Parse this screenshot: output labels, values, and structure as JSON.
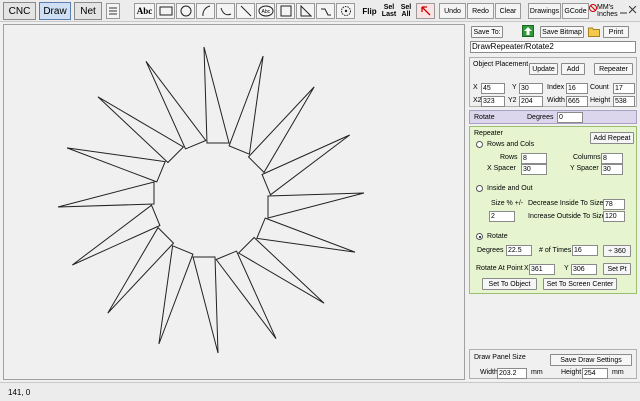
{
  "toolbar": {
    "tabs": [
      "CNC",
      "Draw",
      "Net"
    ],
    "active_tab": "Draw",
    "text_tool": "Abc",
    "flip_label": "Flip",
    "sel_last_label": [
      "Sel",
      "Last"
    ],
    "sel_all_label": [
      "Sel",
      "All"
    ],
    "undo_label": "Undo",
    "redo_label": "Redo",
    "clear_label": "Clear",
    "drawings_label": "Drawings",
    "gcode_label": "GCode",
    "units_label": [
      "MM's",
      "Inches"
    ]
  },
  "panel": {
    "save_to_label": "Save To:",
    "save_bitmap_label": "Save Bitmap",
    "print_label": "Print",
    "filename": "DrawRepeater/Rotate2",
    "placement": {
      "title": "Object Placement",
      "update_label": "Update",
      "add_label": "Add",
      "repeater_label": "Repeater",
      "x_label": "X",
      "x_value": "45",
      "y_label": "Y",
      "y_value": "30",
      "index_label": "Index",
      "index_value": "16",
      "count_label": "Count",
      "count_value": "17",
      "x2_label": "X2",
      "x2_value": "323",
      "y2_label": "Y2",
      "y2_value": "204",
      "width_label": "Width",
      "width_value": "665",
      "height_label": "Height",
      "height_value": "538"
    },
    "rotate_bar": {
      "label": "Rotate",
      "degrees_label": "Degrees",
      "degrees_value": "0"
    },
    "repeater": {
      "title": "Repeater",
      "add_repeat_label": "Add Repeat",
      "rows_cols_label": "Rows and Cols",
      "rows_label": "Rows",
      "rows_value": "8",
      "columns_label": "Columns",
      "columns_value": "8",
      "xspacer_label": "X Spacer",
      "xspacer_value": "30",
      "yspacer_label": "Y Spacer",
      "yspacer_value": "30",
      "inside_out_label": "Inside and Out",
      "size_label": "Size % +/-",
      "size_value": "2",
      "decrease_label": "Decrease Inside To Size %",
      "decrease_value": "78",
      "increase_label": "Increase Outside To Size %",
      "increase_value": "120",
      "rotate_label": "Rotate",
      "degrees_label": "Degrees",
      "degrees_value": "22.5",
      "times_label": "# of Times",
      "times_value": "16",
      "div360_label": "÷ 360",
      "rotate_point_label": "Rotate At Point",
      "rp_x_label": "X",
      "rp_x_value": "361",
      "rp_y_label": "Y",
      "rp_y_value": "306",
      "set_pt_label": "Set Pt",
      "set_object_label": "Set To Object",
      "set_center_label": "Set To Screen Center"
    },
    "panel_size": {
      "title": "Draw Panel Size",
      "save_settings_label": "Save Draw Settings",
      "width_label": "Width",
      "width_value": "203.2",
      "width_unit": "mm",
      "height_label": "Height",
      "height_value": "254",
      "height_unit": "mm"
    }
  },
  "status": {
    "coords": "141, 0"
  },
  "drawing": {
    "count": 16,
    "step_degrees": 22.5
  }
}
